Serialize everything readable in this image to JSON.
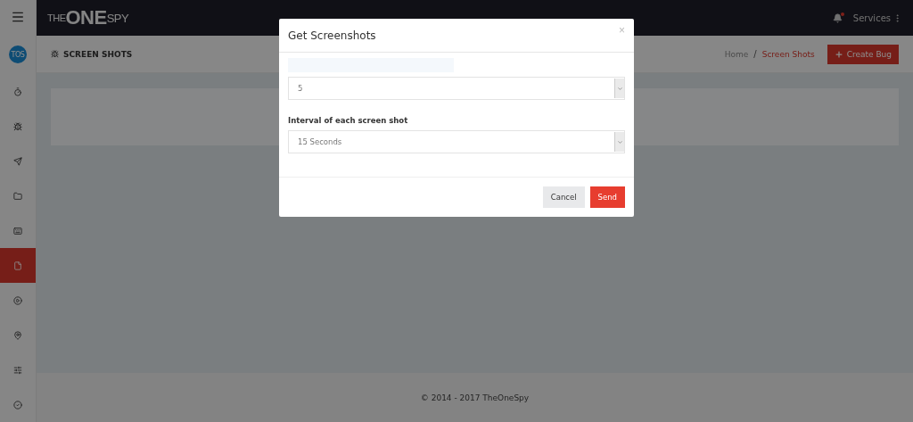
{
  "topbar": {
    "logo": {
      "prefix": "THE",
      "main": "ONE",
      "suffix": "SPY"
    },
    "notification_unread": true,
    "services": "Services"
  },
  "sidebar": {
    "avatar": "TOS",
    "items": [
      {
        "selected": false
      },
      {
        "selected": false
      },
      {
        "selected": false
      },
      {
        "selected": false
      },
      {
        "selected": false
      },
      {
        "selected": true
      },
      {
        "selected": false
      },
      {
        "selected": false
      },
      {
        "selected": false
      },
      {
        "selected": false
      }
    ]
  },
  "page_header": {
    "title": "SCREEN SHOTS",
    "breadcrumb": [
      {
        "label": "Home",
        "selected": false
      },
      {
        "label": "Screen Shots",
        "selected": true
      }
    ],
    "breadcrumb_separator": "/",
    "action": "Create Bug"
  },
  "footer": "© 2014 - 2017 TheOneSpy",
  "modal": {
    "title": "Get Screenshots",
    "close": "×",
    "fields": [
      {
        "value": "5"
      },
      {
        "label": "Interval of each screen shot",
        "value": "15 Seconds"
      }
    ],
    "buttons": [
      {
        "label": "Cancel",
        "kind": "default"
      },
      {
        "label": "Send",
        "kind": "primary"
      }
    ]
  }
}
